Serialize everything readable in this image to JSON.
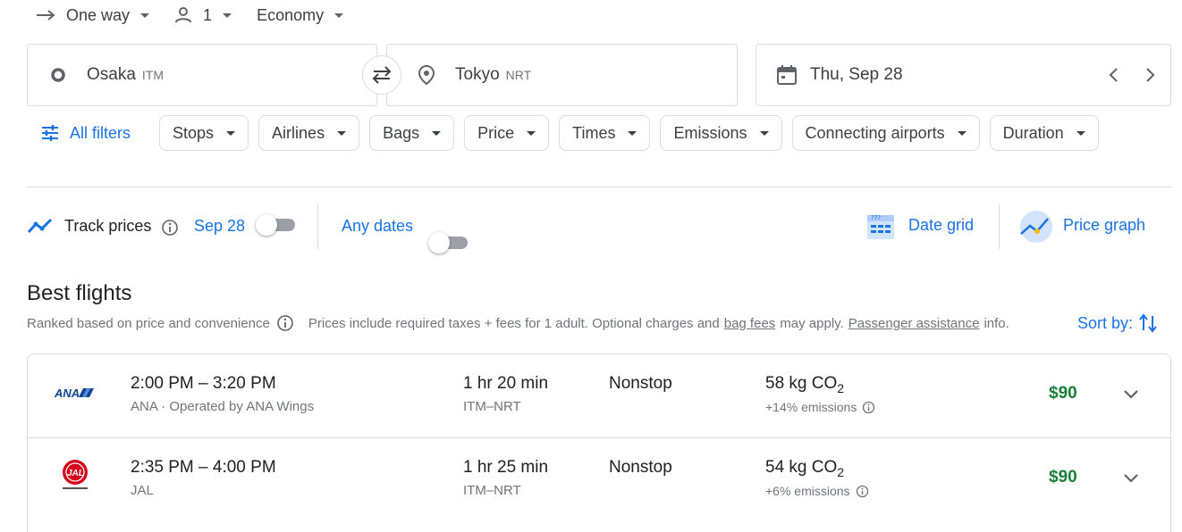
{
  "search": {
    "trip_type": "One way",
    "passengers": "1",
    "cabin": "Economy",
    "origin_city": "Osaka",
    "origin_code": "ITM",
    "destination_city": "Tokyo",
    "destination_code": "NRT",
    "date": "Thu, Sep 28"
  },
  "filters": {
    "all_filters_label": "All filters",
    "chips": [
      "Stops",
      "Airlines",
      "Bags",
      "Price",
      "Times",
      "Emissions",
      "Connecting airports",
      "Duration"
    ]
  },
  "track": {
    "label": "Track prices",
    "date": "Sep 28",
    "any_dates": "Any dates",
    "date_grid": "Date grid",
    "price_graph": "Price graph"
  },
  "results": {
    "title": "Best flights",
    "subtitle": "Ranked based on price and convenience",
    "disclaimer_pre": "Prices include required taxes + fees for 1 adult. Optional charges and",
    "bag_fees": "bag fees",
    "may_apply": "may apply.",
    "passenger_assistance": "Passenger assistance",
    "info": "info.",
    "sort_by": "Sort by:",
    "flights": [
      {
        "airline_logo_text": "ANA",
        "times": "2:00 PM – 3:20 PM",
        "airline": "ANA · Operated by ANA Wings",
        "duration": "1 hr 20 min",
        "route": "ITM–NRT",
        "stops": "Nonstop",
        "co2": "58 kg CO",
        "co2_sub": "2",
        "emissions": "+14% emissions",
        "price": "$90"
      },
      {
        "airline_logo_text": "JAL",
        "times": "2:35 PM – 4:00 PM",
        "airline": "JAL",
        "duration": "1 hr 25 min",
        "route": "ITM–NRT",
        "stops": "Nonstop",
        "co2": "54 kg CO",
        "co2_sub": "2",
        "emissions": "+6% emissions",
        "price": "$90"
      }
    ]
  },
  "colors": {
    "accent": "#1a73e8",
    "price_green": "#188038",
    "border": "#dadce0"
  }
}
